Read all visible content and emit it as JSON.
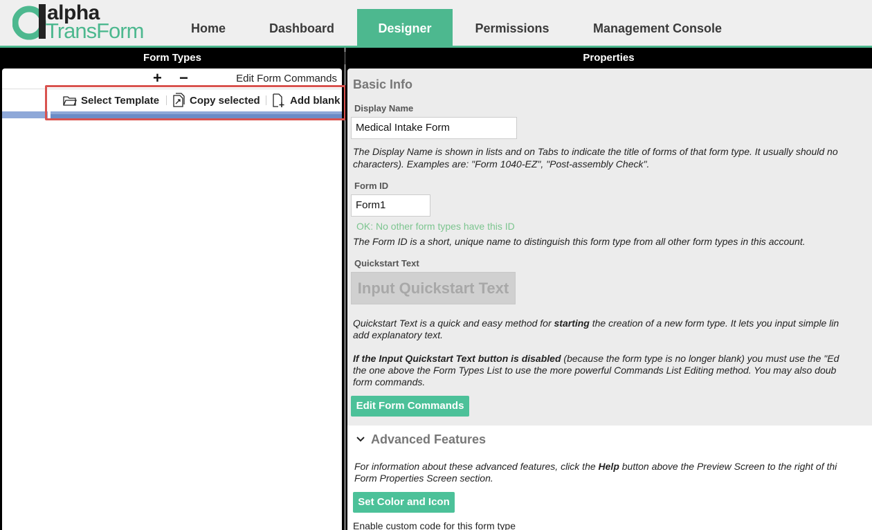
{
  "brand": {
    "logo_top": "alpha",
    "logo_bottom": "TransForm",
    "accent": "#4db88f"
  },
  "nav": {
    "items": [
      {
        "label": "Home",
        "active": false
      },
      {
        "label": "Dashboard",
        "active": false
      },
      {
        "label": "Designer",
        "active": true
      },
      {
        "label": "Permissions",
        "active": false
      },
      {
        "label": "Management Console",
        "active": false
      }
    ]
  },
  "left": {
    "header": "Form Types",
    "toolbar": {
      "plus": "+",
      "minus": "−",
      "edit_label": "Edit Form Commands"
    },
    "commands": {
      "select_template": "Select Template",
      "copy_selected": "Copy selected",
      "add_blank": "Add blank"
    }
  },
  "right": {
    "header": "Properties",
    "basic_info": "Basic Info",
    "display_name": {
      "label": "Display Name",
      "value": "Medical Intake Form",
      "desc_line1": "The Display Name is shown in lists and on Tabs to indicate the title of forms of that form type. It usually should no",
      "desc_line2": "characters). Examples are: \"Form 1040-EZ\", \"Post-assembly Check\"."
    },
    "form_id": {
      "label": "Form ID",
      "value": "Form1",
      "ok_text": "OK: No other form types have this ID",
      "desc": "The Form ID is a short, unique name to distinguish this form type from all other form types in this account."
    },
    "quickstart": {
      "label": "Quickstart Text",
      "button": "Input Quickstart Text",
      "desc1_pre": "Quickstart Text is a quick and easy method for ",
      "desc1_bold": "starting",
      "desc1_post": " the creation of a new form type. It lets you input simple lin",
      "desc1_line2": "add explanatory text.",
      "desc2_bold": "If the Input Quickstart Text button is disabled",
      "desc2_post": " (because the form type is no longer blank) you must use the \"Ed",
      "desc2_line2": "the one above the Form Types List to use the more powerful Commands List Editing method. You may also doub",
      "desc2_line3": "form commands."
    },
    "edit_commands_button": "Edit Form Commands",
    "advanced": {
      "title": "Advanced Features",
      "desc_pre": "For information about these advanced features, click the ",
      "desc_bold": "Help",
      "desc_post": " button above the Preview Screen to the right of thi",
      "desc_line2": "Form Properties Screen section.",
      "color_icon_button": "Set Color and Icon",
      "custom_code": "Enable custom code for this form type"
    }
  }
}
